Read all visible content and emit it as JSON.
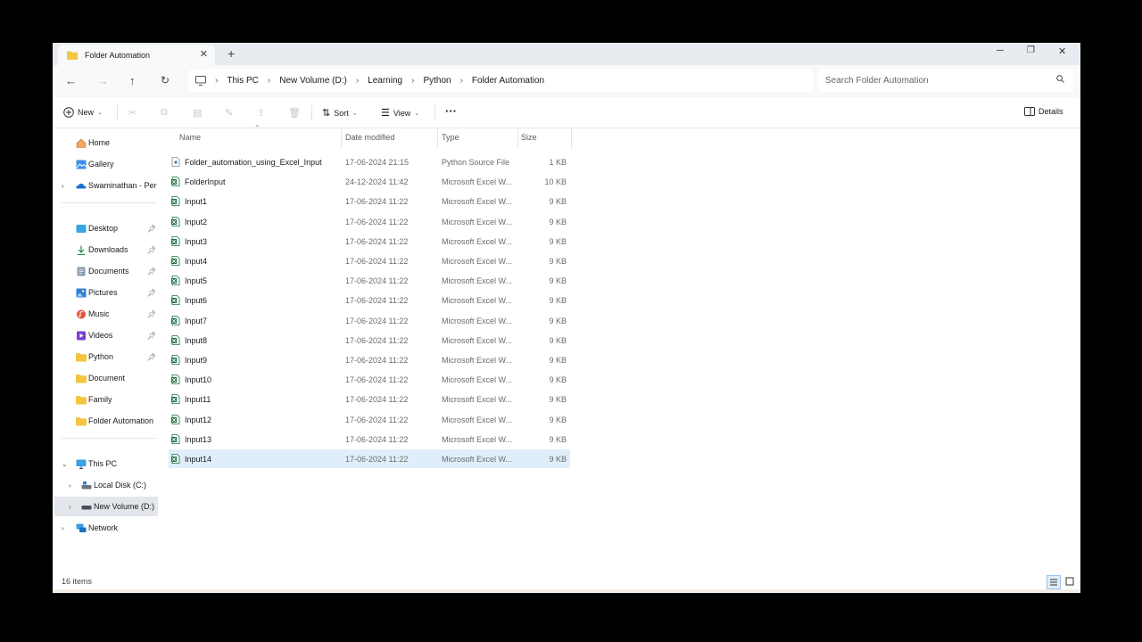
{
  "tab": {
    "title": "Folder Automation"
  },
  "address": {
    "crumbs": [
      "This PC",
      "New Volume (D:)",
      "Learning",
      "Python",
      "Folder Automation"
    ]
  },
  "search": {
    "placeholder": "Search Folder Automation"
  },
  "toolbar": {
    "new_label": "New",
    "sort_label": "Sort",
    "view_label": "View",
    "more_label": "···",
    "details_label": "Details"
  },
  "sidebar": {
    "items": [
      {
        "label": "Home",
        "icon": "home-icon"
      },
      {
        "label": "Gallery",
        "icon": "gallery-icon"
      },
      {
        "label": "Swaminathan - Personal",
        "icon": "onedrive-icon"
      },
      {
        "label": "Desktop",
        "icon": "desktop-icon"
      },
      {
        "label": "Downloads",
        "icon": "download-icon"
      },
      {
        "label": "Documents",
        "icon": "documents-icon"
      },
      {
        "label": "Pictures",
        "icon": "pictures-icon"
      },
      {
        "label": "Music",
        "icon": "music-icon"
      },
      {
        "label": "Videos",
        "icon": "videos-icon"
      },
      {
        "label": "Python",
        "icon": "folder-icon"
      },
      {
        "label": "Document",
        "icon": "folder-icon"
      },
      {
        "label": "Family",
        "icon": "folder-icon"
      },
      {
        "label": "Folder Automation",
        "icon": "folder-icon"
      },
      {
        "label": "This PC",
        "icon": "pc-icon"
      },
      {
        "label": "Local Disk (C:)",
        "icon": "drive-icon"
      },
      {
        "label": "New Volume (D:)",
        "icon": "drive-icon"
      },
      {
        "label": "Network",
        "icon": "network-icon"
      }
    ]
  },
  "columns": {
    "name": "Name",
    "date": "Date modified",
    "type": "Type",
    "size": "Size"
  },
  "files": [
    {
      "name": "Folder_automation_using_Excel_Input",
      "date": "17-06-2024 21:15",
      "type": "Python Source File",
      "size": "1 KB",
      "icon": "python-file-icon"
    },
    {
      "name": "FolderInput",
      "date": "24-12-2024 11:42",
      "type": "Microsoft Excel W...",
      "size": "10 KB",
      "icon": "excel-file-icon"
    },
    {
      "name": "Input1",
      "date": "17-06-2024 11:22",
      "type": "Microsoft Excel W...",
      "size": "9 KB",
      "icon": "excel-file-icon"
    },
    {
      "name": "Input2",
      "date": "17-06-2024 11:22",
      "type": "Microsoft Excel W...",
      "size": "9 KB",
      "icon": "excel-file-icon"
    },
    {
      "name": "Input3",
      "date": "17-06-2024 11:22",
      "type": "Microsoft Excel W...",
      "size": "9 KB",
      "icon": "excel-file-icon"
    },
    {
      "name": "Input4",
      "date": "17-06-2024 11:22",
      "type": "Microsoft Excel W...",
      "size": "9 KB",
      "icon": "excel-file-icon"
    },
    {
      "name": "Input5",
      "date": "17-06-2024 11:22",
      "type": "Microsoft Excel W...",
      "size": "9 KB",
      "icon": "excel-file-icon"
    },
    {
      "name": "Input6",
      "date": "17-06-2024 11:22",
      "type": "Microsoft Excel W...",
      "size": "9 KB",
      "icon": "excel-file-icon"
    },
    {
      "name": "Input7",
      "date": "17-06-2024 11:22",
      "type": "Microsoft Excel W...",
      "size": "9 KB",
      "icon": "excel-file-icon"
    },
    {
      "name": "Input8",
      "date": "17-06-2024 11:22",
      "type": "Microsoft Excel W...",
      "size": "9 KB",
      "icon": "excel-file-icon"
    },
    {
      "name": "Input9",
      "date": "17-06-2024 11:22",
      "type": "Microsoft Excel W...",
      "size": "9 KB",
      "icon": "excel-file-icon"
    },
    {
      "name": "Input10",
      "date": "17-06-2024 11:22",
      "type": "Microsoft Excel W...",
      "size": "9 KB",
      "icon": "excel-file-icon"
    },
    {
      "name": "Input11",
      "date": "17-06-2024 11:22",
      "type": "Microsoft Excel W...",
      "size": "9 KB",
      "icon": "excel-file-icon"
    },
    {
      "name": "Input12",
      "date": "17-06-2024 11:22",
      "type": "Microsoft Excel W...",
      "size": "9 KB",
      "icon": "excel-file-icon"
    },
    {
      "name": "Input13",
      "date": "17-06-2024 11:22",
      "type": "Microsoft Excel W...",
      "size": "9 KB",
      "icon": "excel-file-icon"
    },
    {
      "name": "Input14",
      "date": "17-06-2024 11:22",
      "type": "Microsoft Excel W...",
      "size": "9 KB",
      "icon": "excel-file-icon"
    }
  ],
  "status": {
    "count": "16 items"
  },
  "colors": {
    "folder": "#f4c542",
    "excel": "#1d6f42",
    "selected_row": "#dfeefa",
    "accent": "#0067c0"
  }
}
